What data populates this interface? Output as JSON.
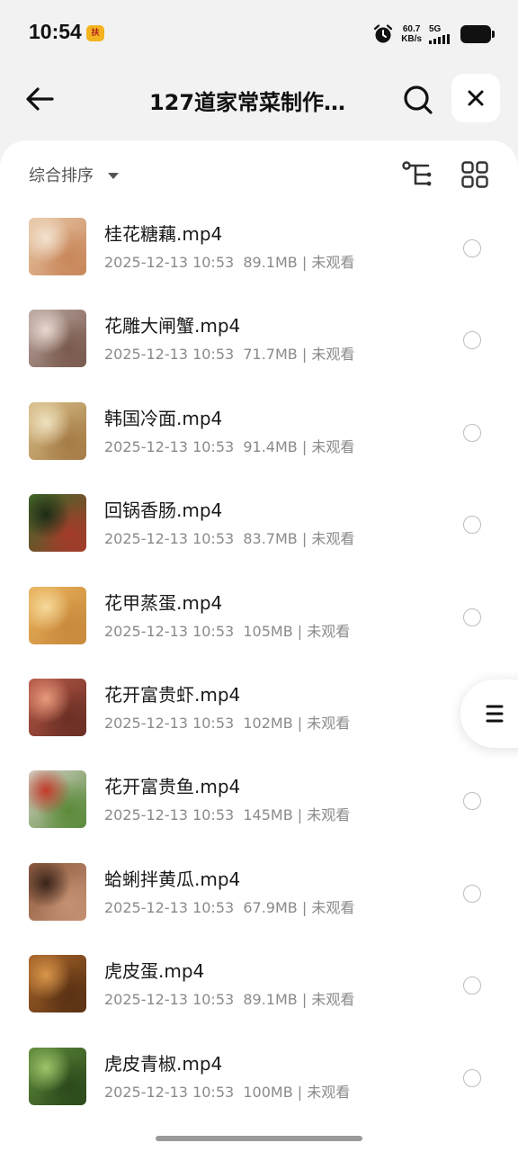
{
  "status_bar": {
    "time": "10:54",
    "app_icon": "扶",
    "net_speed_value": "60.7",
    "net_speed_unit": "KB/s",
    "network_type": "5G",
    "icons": [
      "alarm-icon",
      "signal-icon",
      "battery-icon"
    ]
  },
  "header": {
    "title": "127道家常菜制作…",
    "back_icon": "arrow-left-icon",
    "search_icon": "search-icon",
    "close_icon": "close-icon"
  },
  "toolbar": {
    "sort_label": "综合排序",
    "tree_icon": "tree-view-icon",
    "grid_icon": "grid-view-icon"
  },
  "files": [
    {
      "name": "桂花糖藕.mp4",
      "date": "2025-12-13 10:53",
      "size": "89.1MB",
      "status": "未观看",
      "colors": [
        "#e8c9a8",
        "#c9875b",
        "#f3e2cf"
      ]
    },
    {
      "name": "花雕大闸蟹.mp4",
      "date": "2025-12-13 10:53",
      "size": "71.7MB",
      "status": "未观看",
      "colors": [
        "#b9a6a0",
        "#7a5a4e",
        "#e8d8cf"
      ]
    },
    {
      "name": "韩国冷面.mp4",
      "date": "2025-12-13 10:53",
      "size": "91.4MB",
      "status": "未观看",
      "colors": [
        "#d9c08a",
        "#a67c46",
        "#efe2c0"
      ]
    },
    {
      "name": "回锅香肠.mp4",
      "date": "2025-12-13 10:53",
      "size": "83.7MB",
      "status": "未观看",
      "colors": [
        "#3d6b2a",
        "#a33b2a",
        "#1c2c16"
      ]
    },
    {
      "name": "花甲蒸蛋.mp4",
      "date": "2025-12-13 10:53",
      "size": "105MB",
      "status": "未观看",
      "colors": [
        "#e9b15a",
        "#c98a3c",
        "#f6d99a"
      ]
    },
    {
      "name": "花开富贵虾.mp4",
      "date": "2025-12-13 10:53",
      "size": "102MB",
      "status": "未观看",
      "colors": [
        "#b85a4a",
        "#6b2f24",
        "#e89a7c"
      ]
    },
    {
      "name": "花开富贵鱼.mp4",
      "date": "2025-12-13 10:53",
      "size": "145MB",
      "status": "未观看",
      "colors": [
        "#d8d4cc",
        "#5b8a3a",
        "#c23a2a"
      ]
    },
    {
      "name": "蛤蜊拌黄瓜.mp4",
      "date": "2025-12-13 10:53",
      "size": "67.9MB",
      "status": "未观看",
      "colors": [
        "#8c5a3e",
        "#c49072",
        "#3a241a"
      ]
    },
    {
      "name": "虎皮蛋.mp4",
      "date": "2025-12-13 10:53",
      "size": "89.1MB",
      "status": "未观看",
      "colors": [
        "#a8642a",
        "#5a3214",
        "#d8964a"
      ]
    },
    {
      "name": "虎皮青椒.mp4",
      "date": "2025-12-13 10:53",
      "size": "100MB",
      "status": "未观看",
      "colors": [
        "#5f8a3a",
        "#2c4a1c",
        "#9ec46a"
      ]
    }
  ],
  "float_menu_icon": "menu-icon"
}
